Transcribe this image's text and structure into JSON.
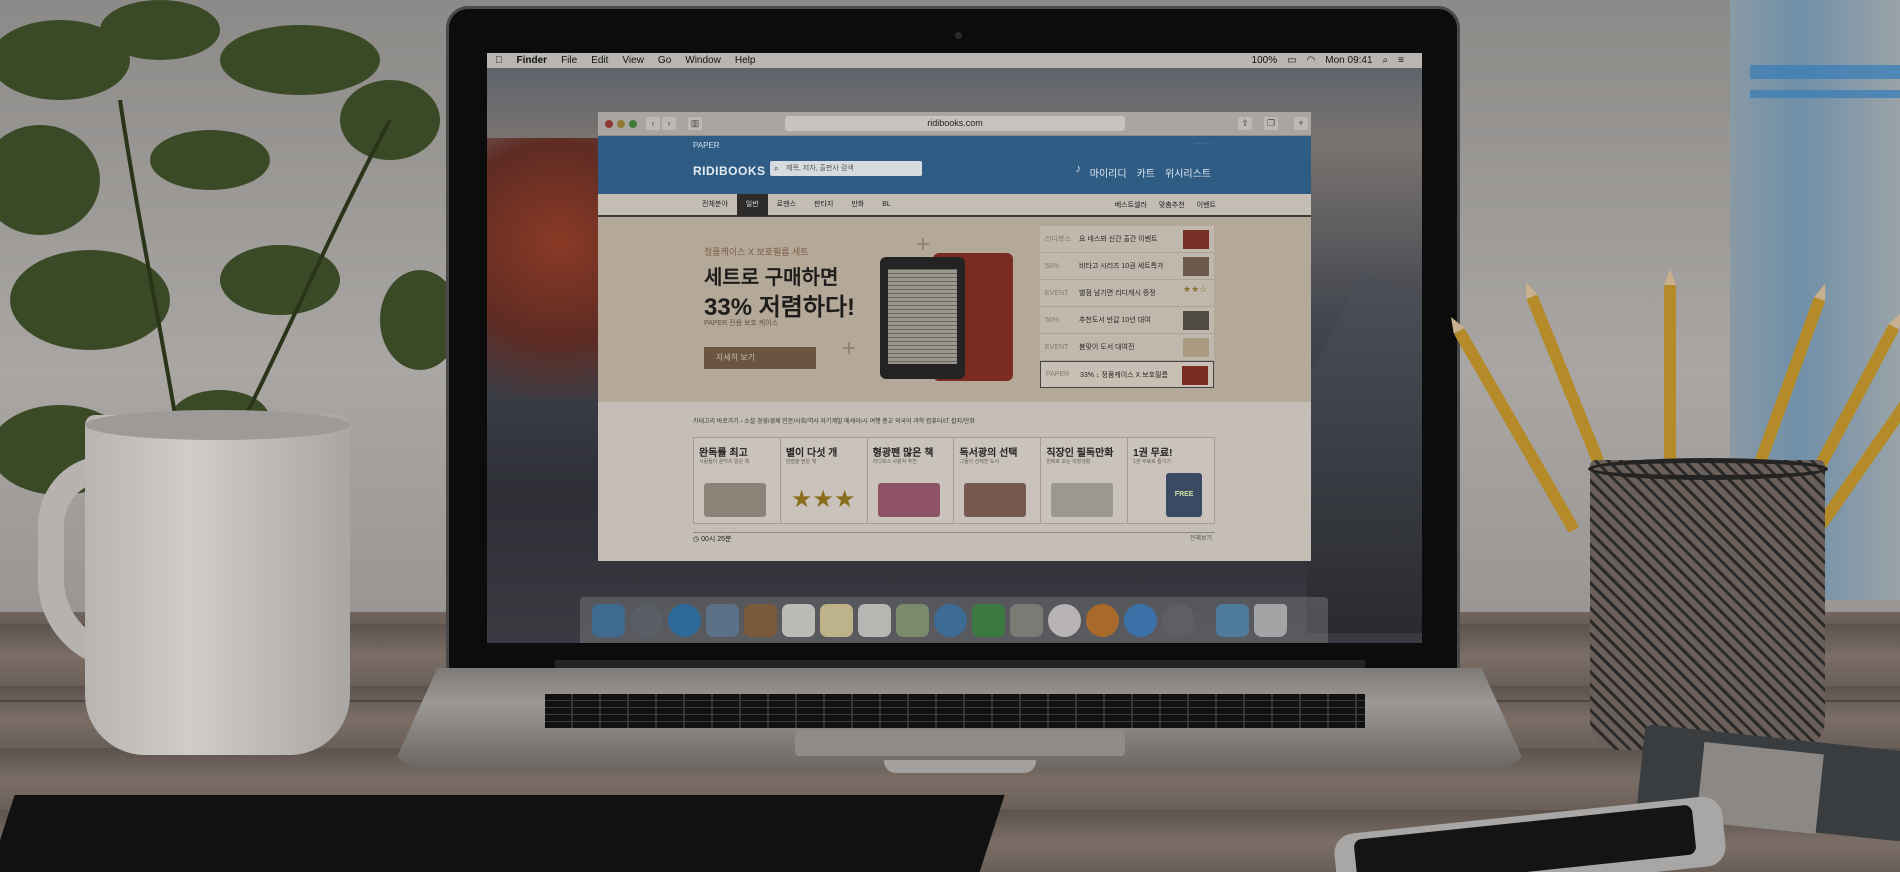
{
  "menubar": {
    "app": "Finder",
    "items": [
      "File",
      "Edit",
      "View",
      "Go",
      "Window",
      "Help"
    ],
    "battery": "100%",
    "clock": "Mon 09:41"
  },
  "browser": {
    "url": "ridibooks.com"
  },
  "site": {
    "paper_label": "PAPER",
    "logo": "RIDIBOOKS",
    "search_placeholder": "제목, 저자, 출판사 검색",
    "user_links": [
      "마이리디",
      "카트",
      "위시리스트"
    ],
    "categories": [
      "전체분야",
      "일반",
      "로맨스",
      "판타지",
      "만화",
      "BL"
    ],
    "category_links_right": [
      "베스트셀러",
      "맞춤추천",
      "이벤트"
    ]
  },
  "banner": {
    "tag": "정품케이스 X 보호필름 세트",
    "headline_1": "세트로 구매하면",
    "headline_2": "33% 저렴하다!",
    "subtitle": "PAPER 전용 보호 케이스",
    "button": "자세히 보기",
    "side_items": [
      {
        "tag": "리디북스",
        "text": "요 네스뵈 신간 출간 이벤트"
      },
      {
        "tag": "58%",
        "text": "비타고 시리즈 10권 세트특가"
      },
      {
        "tag": "EVENT",
        "text": "별점 남기면 리디캐시 증정"
      },
      {
        "tag": "50%",
        "text": "추천도서 반값 10년 대여"
      },
      {
        "tag": "EVENT",
        "text": "봄맞이 도서 대여전"
      },
      {
        "tag": "PAPER",
        "text": "33% ↓ 정품케이스 X 보호필름"
      }
    ]
  },
  "section": {
    "genres": "카테고리 바로가기 ›   소설   경영/경제   인문/사회/역사   자기계발   에세이/시   여행   종교   외국어   과학   컴퓨터/IT   잡지/만화",
    "cards": [
      {
        "title": "완독률 최고",
        "subtitle": "사람들이 끝까지 읽은 책"
      },
      {
        "title": "별이 다섯 개",
        "subtitle": "만점을 받은 책"
      },
      {
        "title": "형광펜 많은 책",
        "subtitle": "리디북스 사용자 추천"
      },
      {
        "title": "독서광의 선택",
        "subtitle": "그들이 선택한 도서"
      },
      {
        "title": "직장인 필독만화",
        "subtitle": "만화로 보는 직장생활"
      },
      {
        "title": "1권 무료!",
        "subtitle": "1권 무료로 즐기기",
        "badge": "FREE"
      }
    ],
    "time_label": "00시 25분",
    "more_label": "전체보기"
  },
  "colors": {
    "site_blue": "#2e5c85",
    "banner_beige": "#b4a999",
    "case_red": "#7a2c22"
  }
}
